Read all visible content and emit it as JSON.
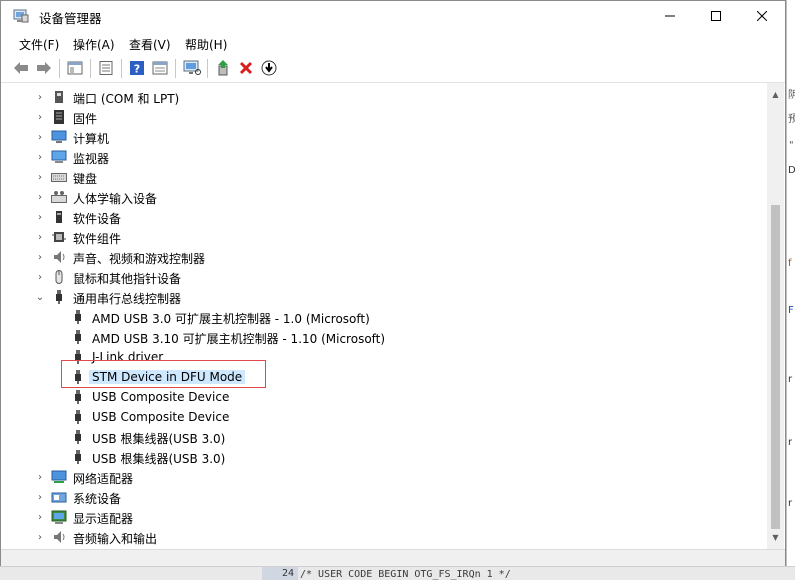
{
  "window": {
    "title": "设备管理器",
    "minimize_glyph": "—",
    "maximize_glyph": "☐",
    "close_glyph": "✕"
  },
  "menu": [
    {
      "label": "文件(F)"
    },
    {
      "label": "操作(A)"
    },
    {
      "label": "查看(V)"
    },
    {
      "label": "帮助(H)"
    }
  ],
  "toolbar": {
    "icons": [
      "back-arrow-icon",
      "forward-arrow-icon",
      "properties-pane-icon",
      "list-view-icon",
      "help-icon",
      "details-view-icon",
      "monitor-scan-icon",
      "update-driver-icon",
      "uninstall-icon",
      "download-icon"
    ]
  },
  "tree": [
    {
      "label": "端口 (COM 和 LPT)",
      "level": 0,
      "expanded": false,
      "icon": "port-icon"
    },
    {
      "label": "固件",
      "level": 0,
      "expanded": false,
      "icon": "firmware-icon"
    },
    {
      "label": "计算机",
      "level": 0,
      "expanded": false,
      "icon": "computer-icon"
    },
    {
      "label": "监视器",
      "level": 0,
      "expanded": false,
      "icon": "monitor-icon"
    },
    {
      "label": "键盘",
      "level": 0,
      "expanded": false,
      "icon": "keyboard-icon"
    },
    {
      "label": "人体学输入设备",
      "level": 0,
      "expanded": false,
      "icon": "hid-icon"
    },
    {
      "label": "软件设备",
      "level": 0,
      "expanded": false,
      "icon": "software-device-icon"
    },
    {
      "label": "软件组件",
      "level": 0,
      "expanded": false,
      "icon": "software-component-icon"
    },
    {
      "label": "声音、视频和游戏控制器",
      "level": 0,
      "expanded": false,
      "icon": "speaker-icon"
    },
    {
      "label": "鼠标和其他指针设备",
      "level": 0,
      "expanded": false,
      "icon": "mouse-icon"
    },
    {
      "label": "通用串行总线控制器",
      "level": 0,
      "expanded": true,
      "icon": "usb-icon"
    },
    {
      "label": "AMD USB 3.0 可扩展主机控制器 - 1.0 (Microsoft)",
      "level": 1,
      "icon": "usb-icon"
    },
    {
      "label": "AMD USB 3.10 可扩展主机控制器 - 1.10 (Microsoft)",
      "level": 1,
      "icon": "usb-icon"
    },
    {
      "label": "J-Link driver",
      "level": 1,
      "icon": "usb-icon"
    },
    {
      "label": "STM Device in DFU Mode",
      "level": 1,
      "icon": "usb-icon",
      "selected": true
    },
    {
      "label": "USB Composite Device",
      "level": 1,
      "icon": "usb-icon"
    },
    {
      "label": "USB Composite Device",
      "level": 1,
      "icon": "usb-icon"
    },
    {
      "label": "USB 根集线器(USB 3.0)",
      "level": 1,
      "icon": "usb-icon"
    },
    {
      "label": "USB 根集线器(USB 3.0)",
      "level": 1,
      "icon": "usb-icon"
    },
    {
      "label": "网络适配器",
      "level": 0,
      "expanded": false,
      "icon": "network-icon"
    },
    {
      "label": "系统设备",
      "level": 0,
      "expanded": false,
      "icon": "system-device-icon"
    },
    {
      "label": "显示适配器",
      "level": 0,
      "expanded": false,
      "icon": "display-adapter-icon"
    },
    {
      "label": "音频输入和输出",
      "level": 0,
      "expanded": false,
      "icon": "audio-icon"
    }
  ],
  "background": {
    "right_fragments": [
      "阴",
      "预",
      "\"",
      "D",
      "f",
      "F",
      "r",
      "r",
      "r"
    ],
    "line_number": "24",
    "code_line": "/* USER CODE BEGIN OTG_FS_IRQn 1 */"
  },
  "colors": {
    "selection": "#cde8ff",
    "highlight_box": "#e04a4a",
    "uninstall_red": "#d81e1e",
    "help_blue": "#2b5fc1"
  }
}
